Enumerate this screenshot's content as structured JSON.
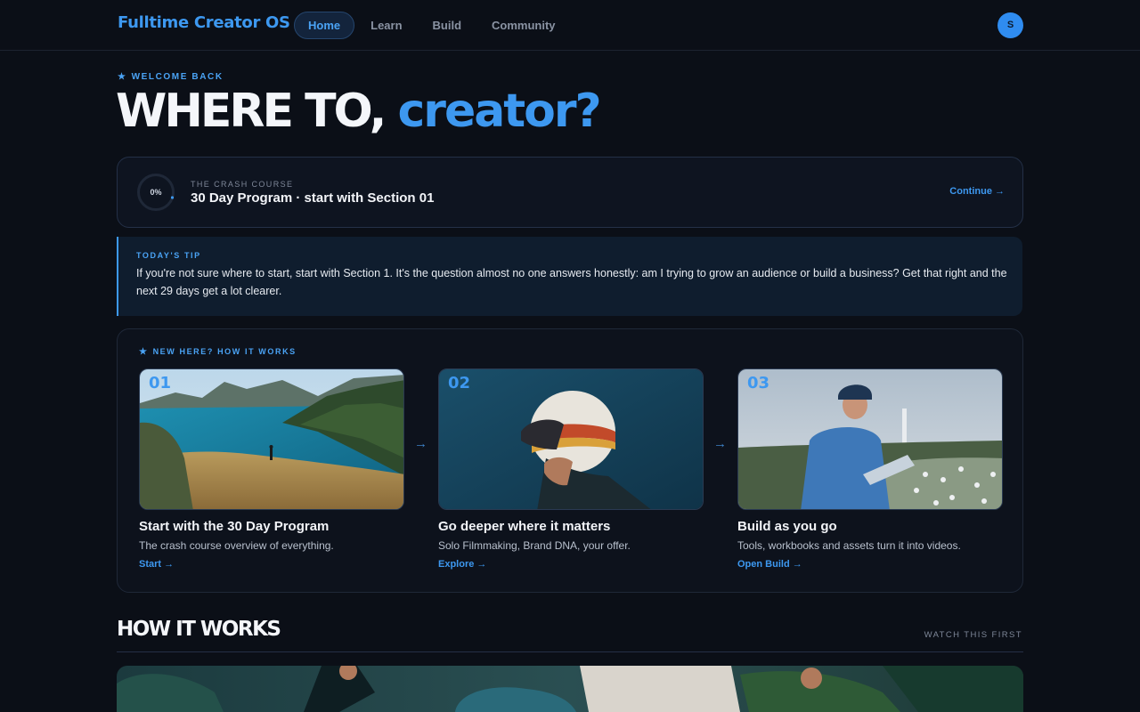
{
  "app": {
    "brand": "Fulltime Creator OS"
  },
  "nav": {
    "items": [
      {
        "label": "Home",
        "active": true
      },
      {
        "label": "Learn",
        "active": false
      },
      {
        "label": "Build",
        "active": false
      },
      {
        "label": "Community",
        "active": false
      }
    ],
    "avatar_initial": "S"
  },
  "hero": {
    "eyebrow": "WELCOME BACK",
    "title_main": "WHERE TO,",
    "title_accent": "creator?"
  },
  "course": {
    "progress_label": "0%",
    "progress": 0,
    "kicker": "THE CRASH COURSE",
    "title": "30 Day Program · start with Section 01",
    "continue_label": "Continue →"
  },
  "tip": {
    "kicker": "TODAY'S TIP",
    "text": "If you're not sure where to start, start with Section 1. It's the question almost no one answers honestly: am I trying to grow an audience or build a business? Get that right and the next 29 days get a lot clearer."
  },
  "steps": {
    "kicker": "NEW HERE? HOW IT WORKS",
    "arrow": "→",
    "items": [
      {
        "num": "01",
        "title": "Start with the 30 Day Program",
        "desc": "The crash course overview of everything.",
        "link": "Start →"
      },
      {
        "num": "02",
        "title": "Go deeper where it matters",
        "desc": "Solo Filmmaking, Brand DNA, your offer.",
        "link": "Explore →"
      },
      {
        "num": "03",
        "title": "Build as you go",
        "desc": "Tools, workbooks and assets turn it into videos.",
        "link": "Open Build →"
      }
    ]
  },
  "section": {
    "title": "HOW IT WORKS",
    "aside": "WATCH THIS FIRST"
  },
  "colors": {
    "accent": "#3d98f0",
    "background": "#0b0f17",
    "card": "#0e1420"
  }
}
